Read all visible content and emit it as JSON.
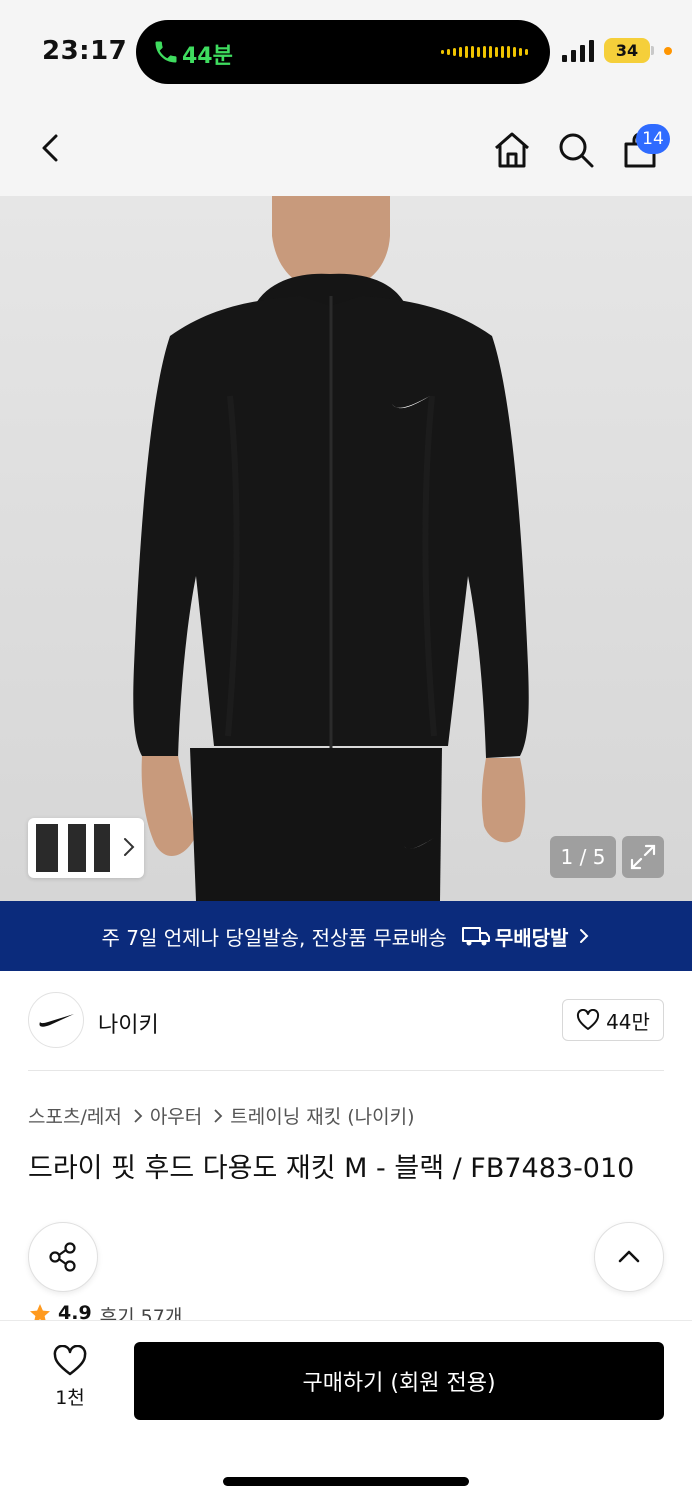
{
  "status_bar": {
    "time": "23:17",
    "call_duration": "44분",
    "battery": "34",
    "call_color": "#3fdc5f",
    "battery_color": "#f5cf3a"
  },
  "nav": {
    "back_icon": "chevron-left-icon",
    "home_icon": "home-icon",
    "search_icon": "search-icon",
    "cart_icon": "shopping-bag-icon",
    "cart_badge": "14",
    "badge_color": "#2f6bff"
  },
  "gallery": {
    "counter": "1 / 5",
    "expand_icon": "expand-icon"
  },
  "banner": {
    "text": "주 7일 언제나 당일발송, 전상품 무료배송",
    "brand": "무배당발",
    "background": "#0b2b7c"
  },
  "brand": {
    "name": "나이키",
    "follow_count": "44만"
  },
  "product": {
    "breadcrumb": [
      "스포츠/레저",
      "아우터",
      "트레이닝 재킷 (나이키)"
    ],
    "title": "드라이 핏 후드 다용도 재킷 M - 블랙 / FB7483-010",
    "rating": "4.9",
    "reviews": "후기 57개",
    "star_color": "#ff9a1f"
  },
  "bottom": {
    "wish_count": "1천",
    "buy_label": "구매하기 (회원 전용)"
  }
}
